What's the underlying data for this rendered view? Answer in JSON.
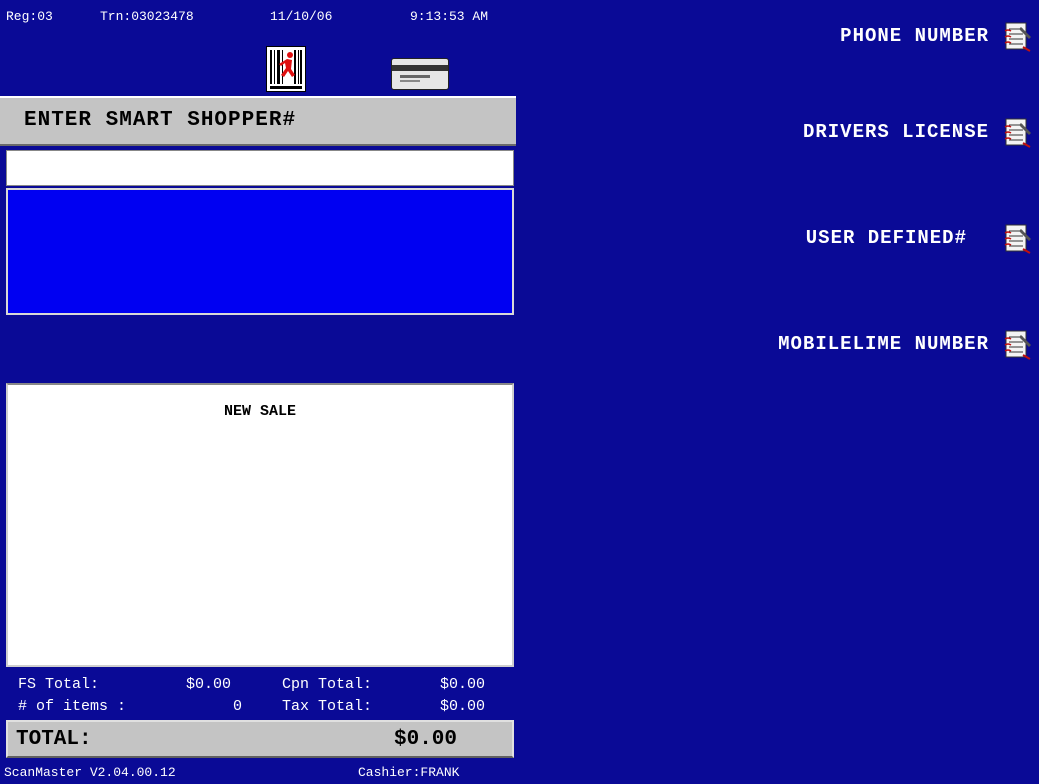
{
  "header": {
    "register": "Reg:03",
    "transaction": "Trn:03023478",
    "date": "11/10/06",
    "time": "9:13:53 AM"
  },
  "status_icons": [
    "barcode-runner-icon",
    "credit-card-icon"
  ],
  "prompt": "ENTER SMART SHOPPER#",
  "entry": {
    "value": ""
  },
  "receipt": {
    "title": "NEW SALE"
  },
  "totals": {
    "fs_label": "FS Total:",
    "fs_value": "$0.00",
    "cpn_label": "Cpn Total:",
    "cpn_value": "$0.00",
    "items_label": "# of items :",
    "items_value": "0",
    "tax_label": "Tax Total:",
    "tax_value": "$0.00",
    "total_label": "TOTAL:",
    "total_value": "$0.00"
  },
  "footer": {
    "version": "ScanMaster V2.04.00.12",
    "cashier": "Cashier:FRANK"
  },
  "options": [
    {
      "label": "PHONE NUMBER",
      "icon": "notepad-icon"
    },
    {
      "label": "DRIVERS LICENSE",
      "icon": "notepad-icon"
    },
    {
      "label": "USER DEFINED#",
      "icon": "notepad-icon"
    },
    {
      "label": "MOBILELIME NUMBER",
      "icon": "notepad-icon"
    }
  ],
  "colors": {
    "background": "#0a0a96",
    "message_box": "#0000f2",
    "panel_gray": "#c4c4c4"
  }
}
